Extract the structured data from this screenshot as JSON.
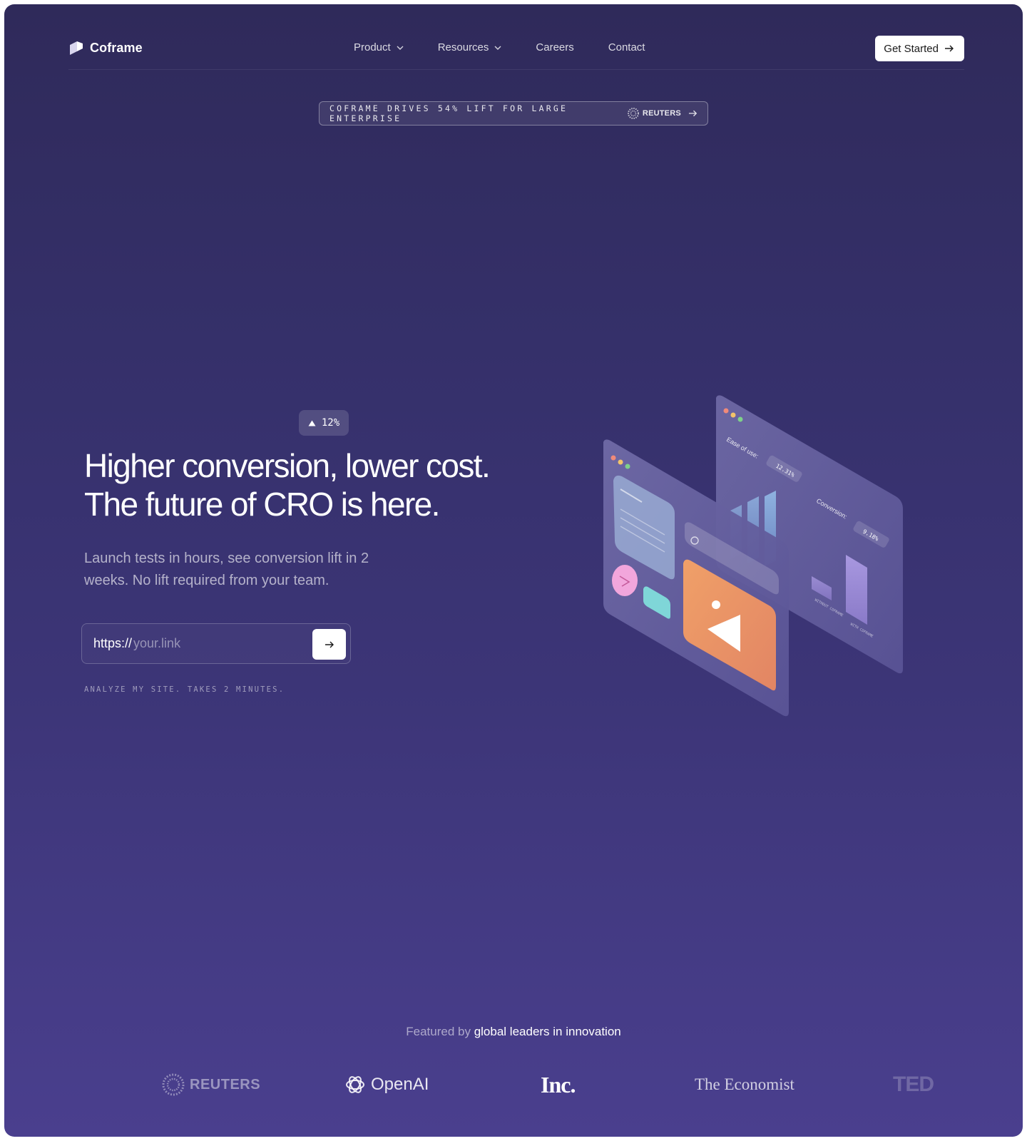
{
  "nav": {
    "brand": "Coframe",
    "links": [
      {
        "label": "Product",
        "dropdown": true
      },
      {
        "label": "Resources",
        "dropdown": true
      },
      {
        "label": "Careers",
        "dropdown": false
      },
      {
        "label": "Contact",
        "dropdown": false
      }
    ],
    "cta": "Get Started"
  },
  "announcement": {
    "text": "COFRAME DRIVES 54% LIFT FOR LARGE ENTERPRISE",
    "partner": "REUTERS"
  },
  "hero": {
    "badge": "12%",
    "headline_line1": "Higher conversion, lower cost.",
    "headline_line2": "The future of CRO is here.",
    "subhead": "Launch tests in hours, see conversion lift in 2 weeks. No lift required from your team.",
    "url_prefix": "https://",
    "url_placeholder": "your.link",
    "hint": "ANALYZE MY SITE. TAKES 2 MINUTES."
  },
  "illustration": {
    "ease_label": "Ease of use:",
    "ease_value": "12.31%",
    "conversion_label": "Conversion:",
    "conversion_value": "9.18%",
    "bar_without": "WITHOUT COFRAME",
    "bar_with": "WITH COFRAME"
  },
  "featured": {
    "prefix": "Featured by ",
    "highlight": "global leaders in innovation",
    "logos": [
      "REUTERS",
      "OpenAI",
      "Inc.",
      "The Economist",
      "TED"
    ]
  },
  "colors": {
    "bg_top": "#2f2a5a",
    "bg_bottom": "#4a3f8e",
    "accent_orange": "#e8956a",
    "accent_pink": "#f0a6d8",
    "accent_teal": "#7fd6d8"
  }
}
